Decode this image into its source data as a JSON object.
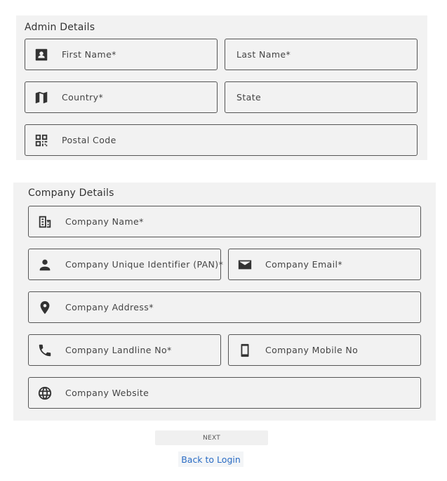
{
  "admin": {
    "title": "Admin Details",
    "first_name": "First Name*",
    "last_name": "Last Name*",
    "country": "Country*",
    "state": "State",
    "postal_code": "Postal Code"
  },
  "company": {
    "title": "Company Details",
    "name": "Company Name*",
    "unique_id": "Company Unique Identifier (PAN)*",
    "email": "Company Email*",
    "address": "Company Address*",
    "landline": "Company Landline No*",
    "mobile": "Company Mobile No",
    "website": "Company Website"
  },
  "actions": {
    "next_label": "NEXT",
    "back_label": "Back to Login"
  },
  "colors": {
    "panel_bg": "#f2f2f2",
    "border": "#555555",
    "link": "#2a6cc4"
  },
  "icons": {
    "first_name": "contact-card-icon",
    "country": "map-icon",
    "postal_code": "qr-code-icon",
    "company_name": "building-icon",
    "unique_id": "person-icon",
    "email": "mail-icon",
    "address": "location-pin-icon",
    "landline": "phone-icon",
    "mobile": "mobile-phone-icon",
    "website": "globe-icon"
  }
}
